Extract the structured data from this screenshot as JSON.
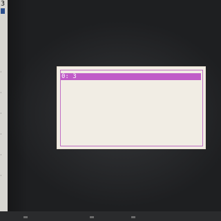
{
  "terminal": {
    "corner_text": "3"
  },
  "menu": {
    "items": [
      {
        "label": "0: 3",
        "selected": true
      }
    ]
  },
  "colors": {
    "selection": "#c05cc8",
    "dialog_background": "#f1ede4",
    "screen_background": "#1e1f21"
  }
}
